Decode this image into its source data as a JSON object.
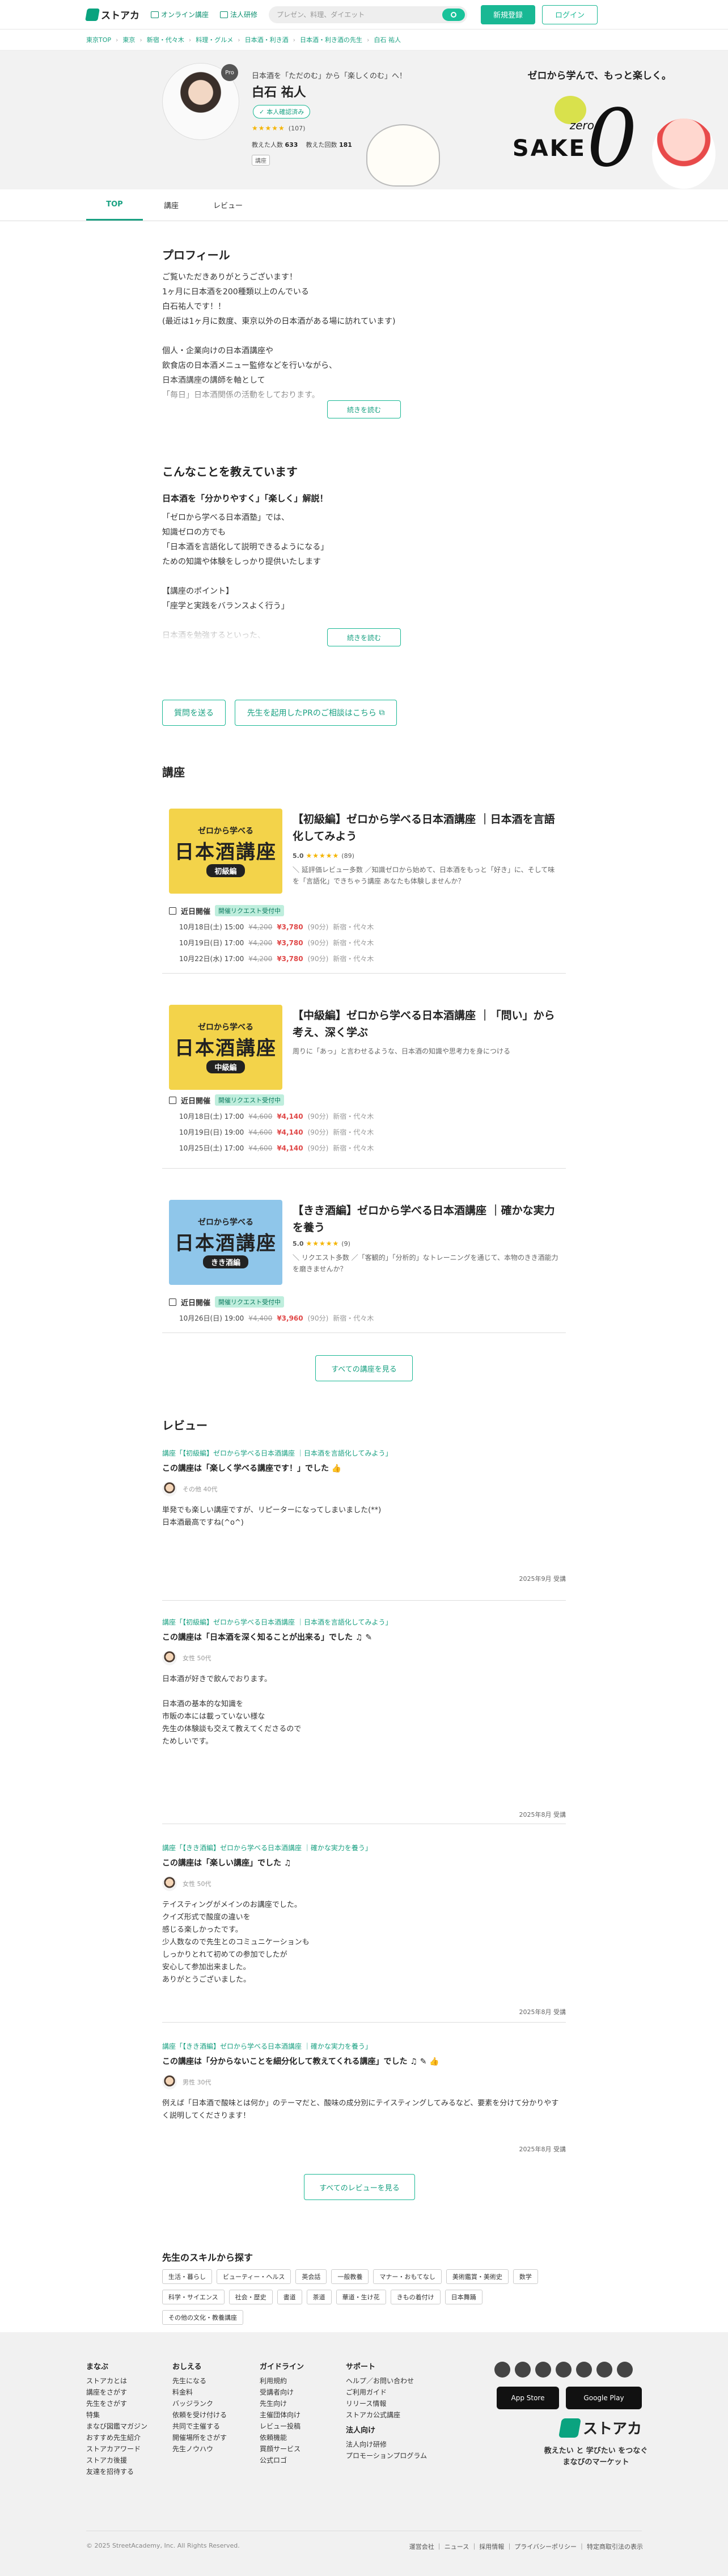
{
  "header": {
    "logo": "ストアカ",
    "online_link": "オンライン講座",
    "corporate_link": "法人研修",
    "search_placeholder": "プレゼン、料理、ダイエット",
    "register": "新規登録",
    "login": "ログイン"
  },
  "breadcrumb": [
    "東京TOP",
    "東京",
    "新宿・代々木",
    "料理・グルメ",
    "日本酒・利き酒",
    "日本酒・利き酒の先生",
    "白石 祐人"
  ],
  "hero": {
    "tagline": "日本酒を「ただのむ」から「楽しくのむ」へ！",
    "name": "白石 祐人",
    "pro_badge": "Pro",
    "id_verified": "本人確認済み",
    "stars": "★★★★★",
    "review_count": "(107)",
    "students_label": "教えた人数",
    "students": "633",
    "sessions_label": "教えた回数",
    "sessions": "181",
    "class_tag": "講座",
    "banner_copy": "ゼロから学んで、もっと楽しく。",
    "banner_zero_small": "zero",
    "banner_sake": "SAKE",
    "banner_zero": "0"
  },
  "tabs": [
    "TOP",
    "講座",
    "レビュー"
  ],
  "profile": {
    "heading": "プロフィール",
    "text": "ご覧いただきありがとうございます！\n1ヶ月に日本酒を200種類以上のんでいる\n白石祐人です！！\n(最近は1ヶ月に数度、東京以外の日本酒がある場に訪れています)\n\n個人・企業向けの日本酒講座や\n飲食店の日本酒メニュー監修などを行いながら、\n日本酒講座の講師を軸として\n「毎日」日本酒関係の活動をしております。\n\nいままでに",
    "more": "続きを読む"
  },
  "teach": {
    "heading": "こんなことを教えています",
    "sub": "日本酒を「分かりやすく」「楽しく」解説！",
    "text": "「ゼロから学べる日本酒塾」では、\n知識ゼロの方でも\n「日本酒を言語化して説明できるようになる」\nための知識や体験をしっかり提供いたします\n\n【講座のポイント】\n「座学と実践をバランスよく行う」\n\n日本酒を勉強するといった、\nテイスティングトレーニングだけをしても",
    "more": "続きを読む"
  },
  "actions": {
    "ask": "質問を送る",
    "pr": "先生を起用したPRのご相談はこちら"
  },
  "courses": {
    "heading": "講座",
    "schedule_label": "近日開催",
    "request_badge": "開催リクエスト受付中",
    "see_all": "すべての講座を見る",
    "items": [
      {
        "thumb_top": "ゼロから学べる",
        "thumb_main": "日本酒講座",
        "thumb_sub": "初級編",
        "thumb_bg": "#f3d34a",
        "title": "【初級編】ゼロから学べる日本酒講座 ｜日本酒を言語化してみよう",
        "rating": "5.0",
        "stars": "★★★★★",
        "count": "(89)",
        "desc": "＼ 延評価レビュー多数 ／知識ゼロから始めて、日本酒をもっと「好き」に、そして味を「言語化」できちゃう講座 あなたも体験しませんか？",
        "slots": [
          {
            "date": "10月18日(土) 15:00",
            "orig": "¥4,200",
            "price": "¥3,780",
            "dur": "(90分)",
            "place": "新宿・代々木"
          },
          {
            "date": "10月19日(日) 17:00",
            "orig": "¥4,200",
            "price": "¥3,780",
            "dur": "(90分)",
            "place": "新宿・代々木"
          },
          {
            "date": "10月22日(水) 17:00",
            "orig": "¥4,200",
            "price": "¥3,780",
            "dur": "(90分)",
            "place": "新宿・代々木"
          }
        ]
      },
      {
        "thumb_top": "ゼロから学べる",
        "thumb_main": "日本酒講座",
        "thumb_sub": "中級編",
        "thumb_bg": "#f3d34a",
        "title": "【中級編】ゼロから学べる日本酒講座 ｜「問い」から考え、深く学ぶ",
        "rating": "",
        "stars": "",
        "count": "",
        "desc": "周りに「あっ」と言わせるような、日本酒の知識や思考力を身につける",
        "slots": [
          {
            "date": "10月18日(土) 17:00",
            "orig": "¥4,600",
            "price": "¥4,140",
            "dur": "(90分)",
            "place": "新宿・代々木"
          },
          {
            "date": "10月19日(日) 19:00",
            "orig": "¥4,600",
            "price": "¥4,140",
            "dur": "(90分)",
            "place": "新宿・代々木"
          },
          {
            "date": "10月25日(土) 17:00",
            "orig": "¥4,600",
            "price": "¥4,140",
            "dur": "(90分)",
            "place": "新宿・代々木"
          }
        ]
      },
      {
        "thumb_top": "ゼロから学べる",
        "thumb_main": "日本酒講座",
        "thumb_sub": "きき酒編",
        "thumb_bg": "#8fc6ea",
        "title": "【きき酒編】ゼロから学べる日本酒講座 ｜確かな実力を養う",
        "rating": "5.0",
        "stars": "★★★★★",
        "count": "(9)",
        "desc": "＼ リクエスト多数 ／「客観的」「分析的」なトレーニングを通じて、本物のきき酒能力を磨きませんか？",
        "slots": [
          {
            "date": "10月26日(日) 19:00",
            "orig": "¥4,400",
            "price": "¥3,960",
            "dur": "(90分)",
            "place": "新宿・代々木"
          }
        ]
      }
    ]
  },
  "reviews": {
    "heading": "レビュー",
    "see_all": "すべてのレビューを見る",
    "items": [
      {
        "course_prefix": "講座「",
        "course": "【初級編】ゼロから学べる日本酒講座 ｜日本酒を言語化してみよう",
        "course_suffix": "」",
        "title": "この講座は「楽しく学べる講座です！」でした",
        "who": "その他 40代",
        "body": "単発でも楽しい講座ですが、リピーターになってしまいました(**)\n日本酒最高ですね(^o^)",
        "date": "2025年9月 受講"
      },
      {
        "course_prefix": "講座「",
        "course": "【初級編】ゼロから学べる日本酒講座 ｜日本酒を言語化してみよう",
        "course_suffix": "」",
        "title": "この講座は「日本酒を深く知ることが出来る」でした",
        "who": "女性 50代",
        "body": "日本酒が好きで飲んでおります。\n\n日本酒の基本的な知識を\n市販の本には載っていない様な\n先生の体験談も交えて教えてくださるので\nためしいです。",
        "date": "2025年8月 受講"
      },
      {
        "course_prefix": "講座「",
        "course": "【きき酒編】ゼロから学べる日本酒講座 ｜確かな実力を養う",
        "course_suffix": "」",
        "title": "この講座は「楽しい講座」でした",
        "who": "女性 50代",
        "body": "テイスティングがメインのお講座でした。\nクイズ形式で酸度の違いを\n感じる楽しかったです。\n少人数なので先生とのコミュニケーションも\nしっかりとれて初めての参加でしたが\n安心して参加出来ました。\nありがとうございました。",
        "date": "2025年8月 受講"
      },
      {
        "course_prefix": "講座「",
        "course": "【きき酒編】ゼロから学べる日本酒講座 ｜確かな実力を養う",
        "course_suffix": "」",
        "title": "この講座は「分からないことを細分化して教えてくれる講座」でした",
        "who": "男性 30代",
        "body": "例えば「日本酒で酸味とは何か」のテーマだと、酸味の成分別にテイスティングしてみるなど、要素を分けて分かりやすく説明してくださります！",
        "date": "2025年8月 受講"
      }
    ]
  },
  "skills": {
    "heading": "先生のスキルから探す",
    "chips": [
      "生活・暮らし",
      "ビューティー・ヘルス",
      "英会話",
      "一般教養",
      "マナー・おもてなし",
      "美術鑑賞・美術史",
      "数学",
      "科学・サイエンス",
      "社会・歴史",
      "書道",
      "茶道",
      "華道・生け花",
      "きもの着付け",
      "日本舞踊",
      "その他の文化・教養講座"
    ]
  },
  "footer": {
    "cols": [
      {
        "title": "まなぶ",
        "items": [
          "ストアカとは",
          "講座をさがす",
          "先生をさがす",
          "特集",
          "まなび図鑑マガジン",
          "おすすめ先生紹介",
          "ストアカアワード",
          "ストアカ後援",
          "友達を招待する"
        ]
      },
      {
        "title": "おしえる",
        "items": [
          "先生になる",
          "料金料",
          "バッジランク",
          "依頼を受け付ける",
          "共同で主催する",
          "開催場所をさがす",
          "先生ノウハウ"
        ]
      },
      {
        "title": "ガイドライン",
        "items": [
          "利用規約",
          "受講者向け",
          "先生向け",
          "主催団体向け",
          "レビュー投稿",
          "依頼機能",
          "買顔サービス",
          "公式ロゴ"
        ]
      },
      {
        "title": "サポート",
        "items": [
          "ヘルプ／お問い合わせ",
          "ご利用ガイド",
          "リリース情報",
          "ストアカ公式講座",
          "法人向け",
          "法人向け研修",
          "プロモーションプログラム"
        ]
      }
    ],
    "app_store": "App Store",
    "google_play": "Google Play",
    "logo": "ストアカ",
    "slogan_1": "教えたい と 学びたい をつなぐ",
    "slogan_2": "まなびのマーケット",
    "copyright": "© 2025 StreetAcademy, Inc. All Rights Reserved.",
    "links": "運営会社 ｜ ニュース ｜ 採用情報 ｜ プライバシーポリシー ｜ 特定商取引法の表示"
  }
}
